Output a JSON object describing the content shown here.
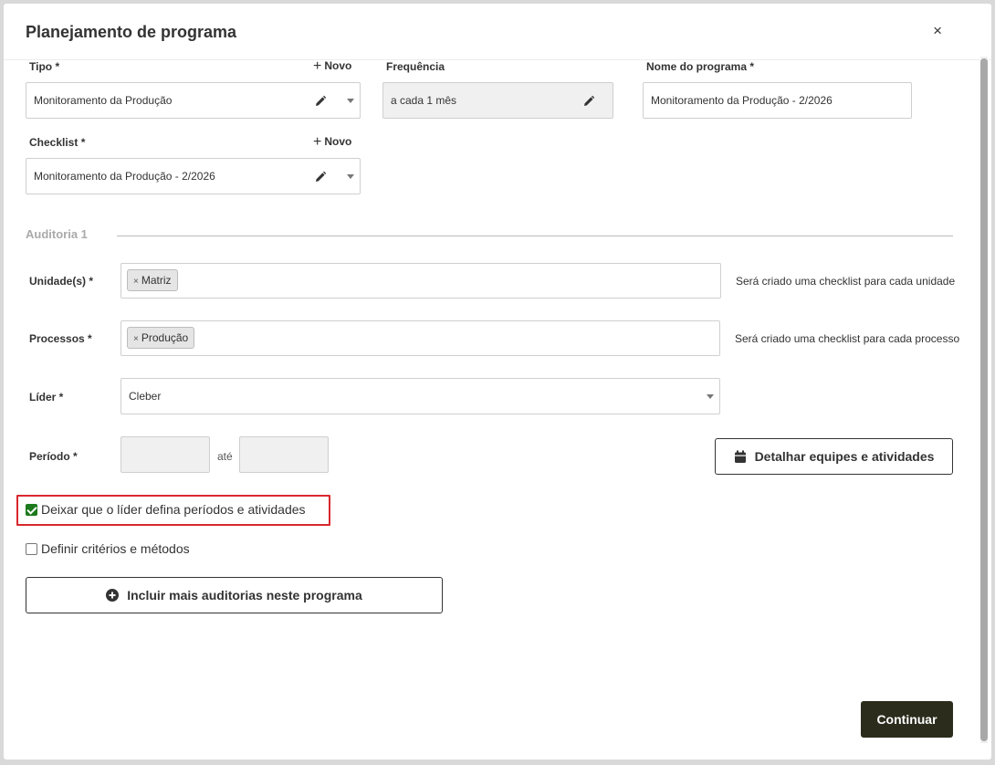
{
  "modal": {
    "title": "Planejamento de programa",
    "close_label": "×"
  },
  "top_fields": {
    "tipo": {
      "label": "Tipo *",
      "new_label": "Novo",
      "value": "Monitoramento da Produção"
    },
    "frequencia": {
      "label": "Frequência",
      "value": "a cada 1 mês"
    },
    "nome_programa": {
      "label": "Nome do programa *",
      "value": "Monitoramento da Produção - 2/2026"
    },
    "checklist": {
      "label": "Checklist *",
      "new_label": "Novo",
      "value": "Monitoramento da Produção - 2/2026"
    }
  },
  "auditoria": {
    "title": "Auditoria 1",
    "unidades": {
      "label": "Unidade(s) *",
      "tags": [
        "Matriz"
      ],
      "hint": "Será criado uma checklist para cada unidade"
    },
    "processos": {
      "label": "Processos *",
      "tags": [
        "Produção"
      ],
      "hint": "Será criado uma checklist para cada processo"
    },
    "lider": {
      "label": "Líder *",
      "value": "Cleber"
    },
    "periodo": {
      "label": "Período *",
      "start": "",
      "end": "",
      "separator": "até"
    },
    "detail_button": "Detalhar equipes e atividades"
  },
  "options": {
    "leader_defines": {
      "label": "Deixar que o líder defina períodos e atividades",
      "checked": true
    },
    "criteria": {
      "label": "Definir critérios e métodos",
      "checked": false
    }
  },
  "add_audit_button": "Incluir mais auditorias neste programa",
  "continue_button": "Continuar",
  "tag_remove_symbol": "×"
}
